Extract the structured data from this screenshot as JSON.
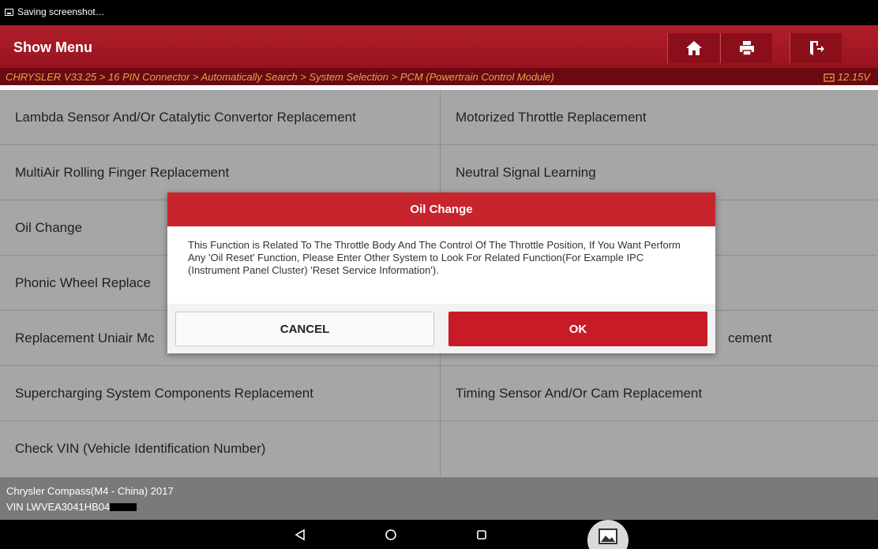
{
  "status_bar": {
    "notification": "Saving screenshot…"
  },
  "app_bar": {
    "title": "Show Menu",
    "buttons": [
      "home-icon",
      "print-icon",
      "exit-icon"
    ]
  },
  "breadcrumb": {
    "path": "CHRYSLER V33.25 > 16 PIN Connector > Automatically Search > System Selection > PCM (Powertrain Control Module)",
    "voltage": "12.15V"
  },
  "menu": {
    "items": [
      {
        "left": "Lambda Sensor And/Or Catalytic Convertor Replacement",
        "right": "Motorized Throttle Replacement"
      },
      {
        "left": "MultiAir Rolling Finger Replacement",
        "right": "Neutral Signal Learning"
      },
      {
        "left": "Oil Change",
        "right": ""
      },
      {
        "left": "Phonic Wheel Replace",
        "right": ""
      },
      {
        "left": "Replacement Uniair Mc",
        "right": "cement"
      },
      {
        "left": "Supercharging System Components Replacement",
        "right": "Timing Sensor And/Or Cam Replacement"
      },
      {
        "left": "Check VIN (Vehicle Identification Number)",
        "right": ""
      }
    ]
  },
  "vehicle": {
    "model": "Chrysler Compass(M4 - China) 2017",
    "vin": "VIN LWVEA3041HB04"
  },
  "dialog": {
    "title": "Oil Change",
    "message": "This Function is Related To The Throttle Body And The Control Of The Throttle Position, If You Want Perform Any 'Oil Reset' Function, Please Enter Other System to Look For Related Function(For Example IPC (Instrument Panel Cluster) 'Reset Service Information').",
    "cancel_label": "CANCEL",
    "ok_label": "OK"
  },
  "colors": {
    "brand_red": "#b01e2a",
    "breadcrumb_text": "#e7a24a",
    "ok_button": "#c71b27"
  }
}
